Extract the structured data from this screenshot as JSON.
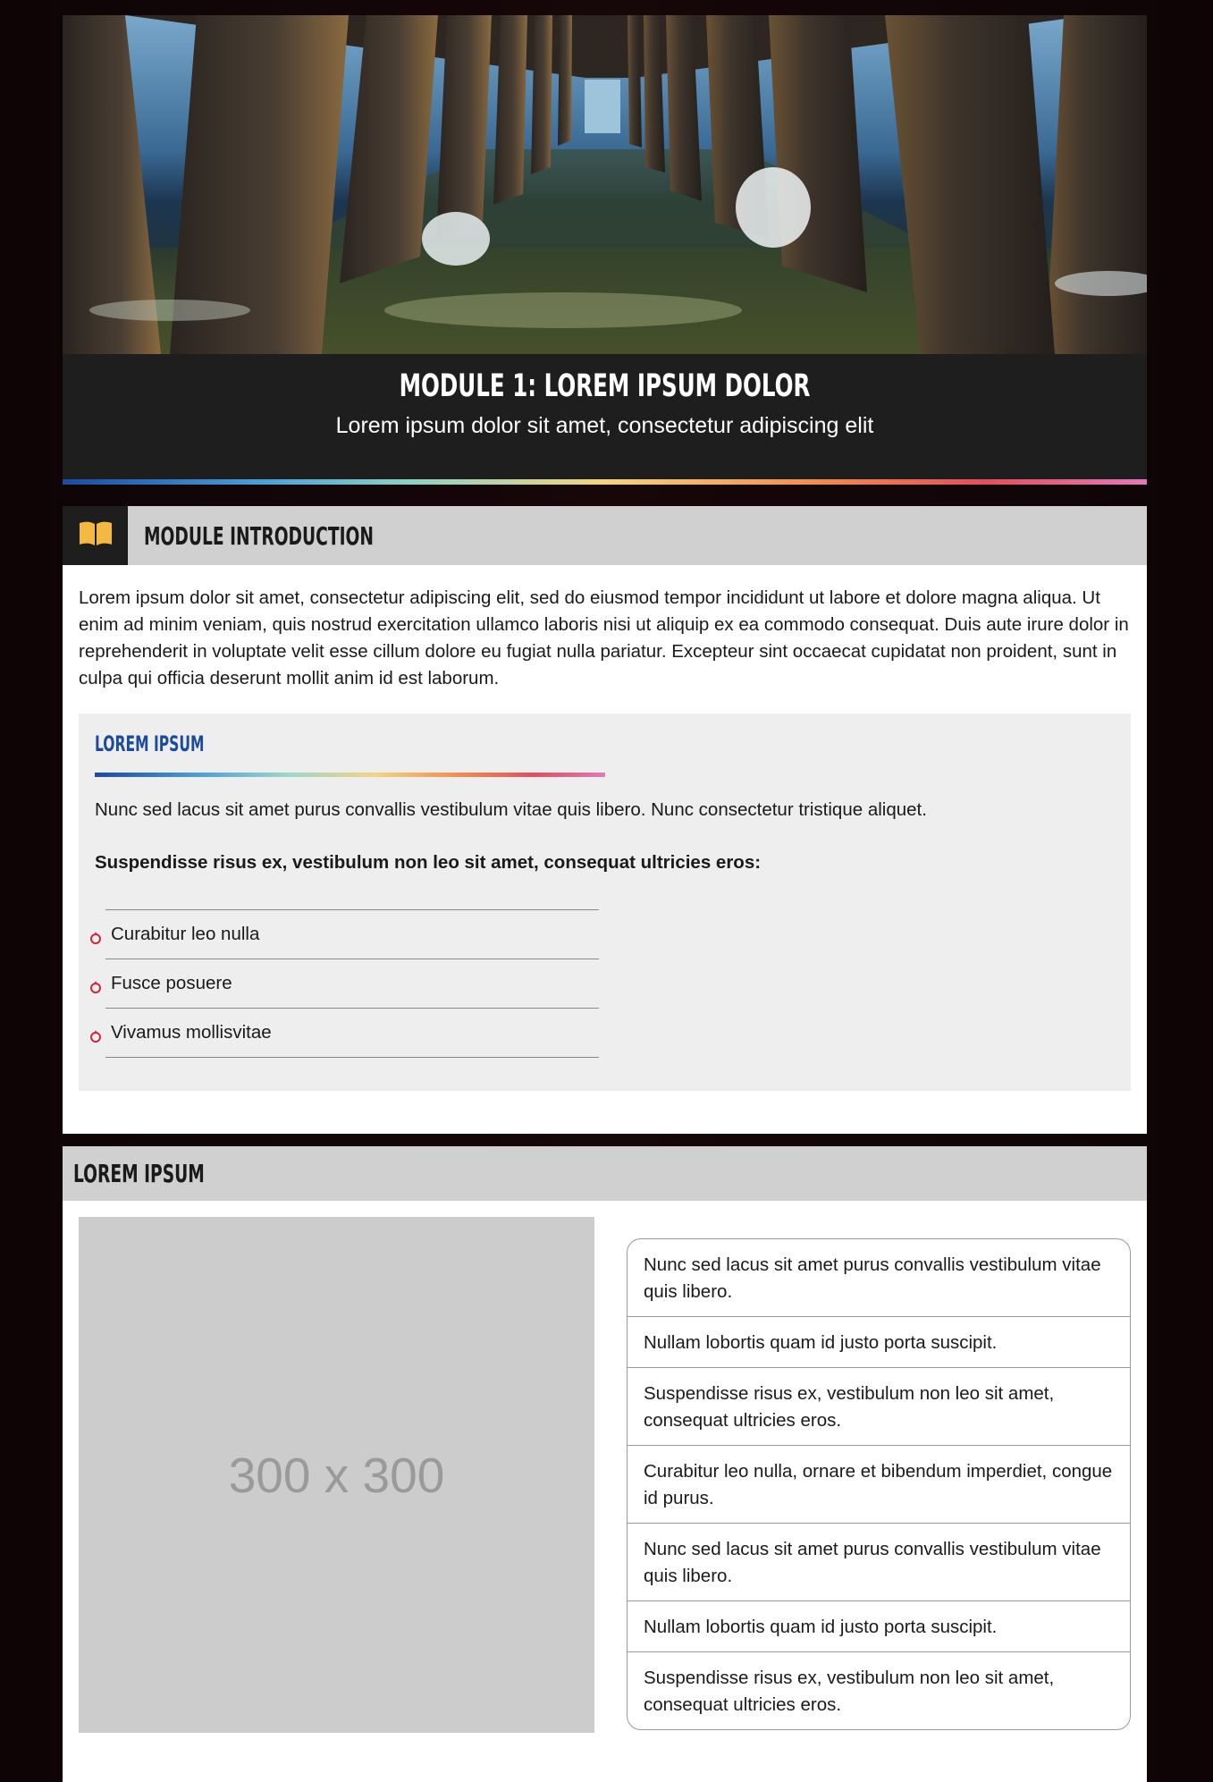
{
  "hero": {
    "title": "MODULE 1: LOREM IPSUM DOLOR",
    "subtitle": "Lorem ipsum dolor sit amet, consectetur adipiscing elit"
  },
  "intro": {
    "icon": "open-book-icon",
    "title": "MODULE INTRODUCTION",
    "text": "Lorem ipsum dolor sit amet, consectetur adipiscing elit, sed do eiusmod tempor incididunt ut labore et dolore magna aliqua. Ut enim ad minim veniam, quis nostrud exercitation ullamco laboris nisi ut aliquip ex ea commodo consequat. Duis aute irure dolor in reprehenderit in voluptate velit esse cillum dolore eu fugiat nulla pariatur. Excepteur sint occaecat cupidatat non proident, sunt in culpa qui officia deserunt mollit anim id est laborum."
  },
  "callout": {
    "title": "LOREM IPSUM",
    "text": "Nunc sed lacus sit amet purus convallis vestibulum vitae quis libero. Nunc consectetur tristique aliquet.",
    "bold_text": "Suspendisse risus ex, vestibulum non leo sit amet, consequat ultricies eros:",
    "bullet_icon": "flame-icon",
    "items": [
      {
        "label": "Curabitur leo nulla"
      },
      {
        "label": "Fusce posuere"
      },
      {
        "label": "Vivamus mollisvitae"
      }
    ]
  },
  "section2": {
    "title": "LOREM IPSUM",
    "placeholder_label": "300 x 300",
    "items": [
      {
        "text": "Nunc sed lacus sit amet purus convallis vestibulum vitae quis libero."
      },
      {
        "text": "Nullam lobortis quam id justo porta suscipit."
      },
      {
        "text": "Suspendisse risus ex, vestibulum non leo sit amet, consequat ultricies eros."
      },
      {
        "text": "Curabitur leo nulla, ornare et bibendum imperdiet, congue id purus."
      },
      {
        "text": "Nunc sed lacus sit amet purus convallis vestibulum vitae quis libero."
      },
      {
        "text": "Nullam lobortis quam id justo porta suscipit."
      },
      {
        "text": "Suspendisse risus ex, vestibulum non leo sit amet, consequat ultricies eros."
      }
    ]
  },
  "colors": {
    "accent_blue": "#1d4b9c",
    "bullet_red": "#d0253a",
    "icon_yellow": "#f4b942",
    "dark": "#1e1e1e",
    "header_gray": "#d0d0d0"
  }
}
